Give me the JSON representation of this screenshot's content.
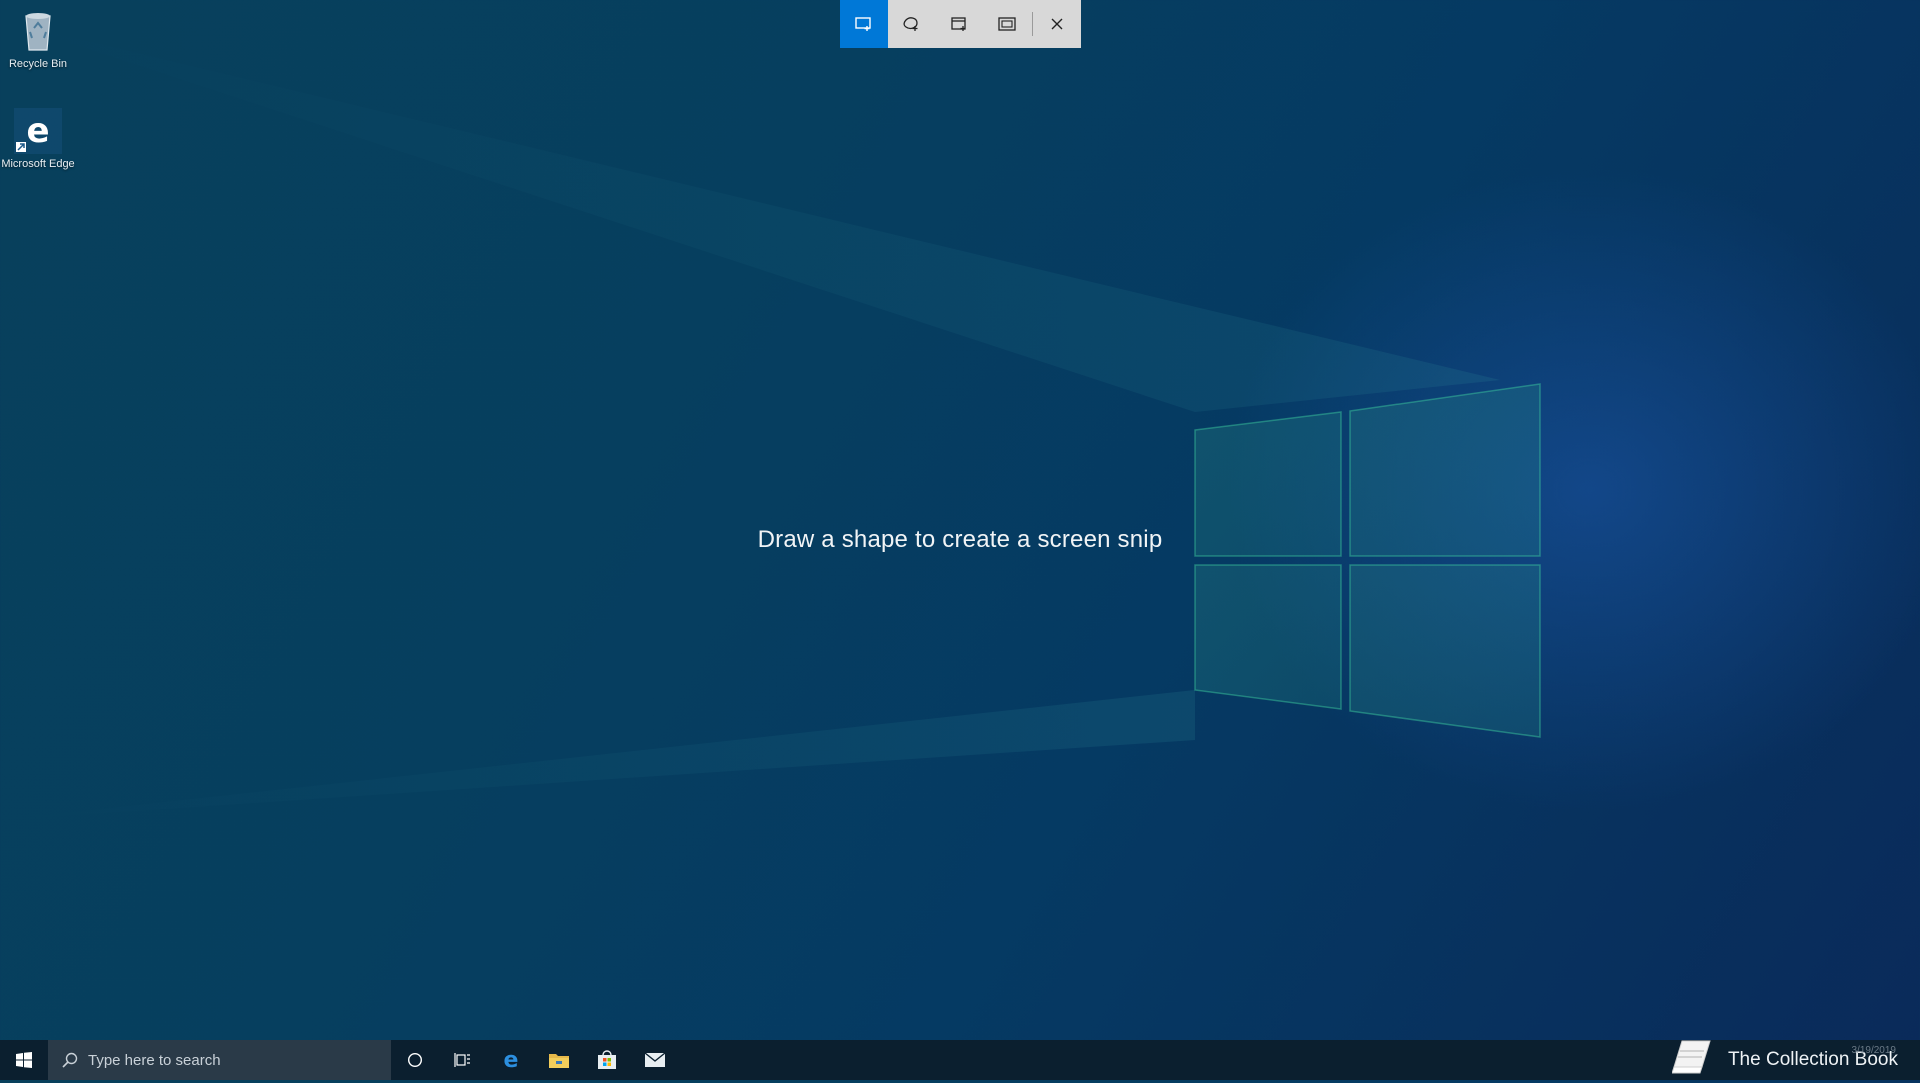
{
  "desktop": {
    "icons": [
      {
        "label": "Recycle Bin",
        "icon": "recycle-bin-icon"
      },
      {
        "label": "Microsoft Edge",
        "icon": "edge-icon"
      }
    ]
  },
  "snip_toolbar": {
    "modes": [
      {
        "icon": "rectangular-snip-icon",
        "active": true
      },
      {
        "icon": "freeform-snip-icon",
        "active": false
      },
      {
        "icon": "window-snip-icon",
        "active": false
      },
      {
        "icon": "fullscreen-snip-icon",
        "active": false
      }
    ],
    "close_icon": "close-icon",
    "active_color": "#0078d7"
  },
  "hint": "Draw a shape to create a screen snip",
  "taskbar": {
    "search_placeholder": "Type here to search",
    "apps": [
      "cortana-icon",
      "task-view-icon",
      "edge-icon",
      "file-explorer-icon",
      "store-icon",
      "mail-icon"
    ],
    "date": "3/19/2019"
  },
  "watermark": "The Collection Book"
}
